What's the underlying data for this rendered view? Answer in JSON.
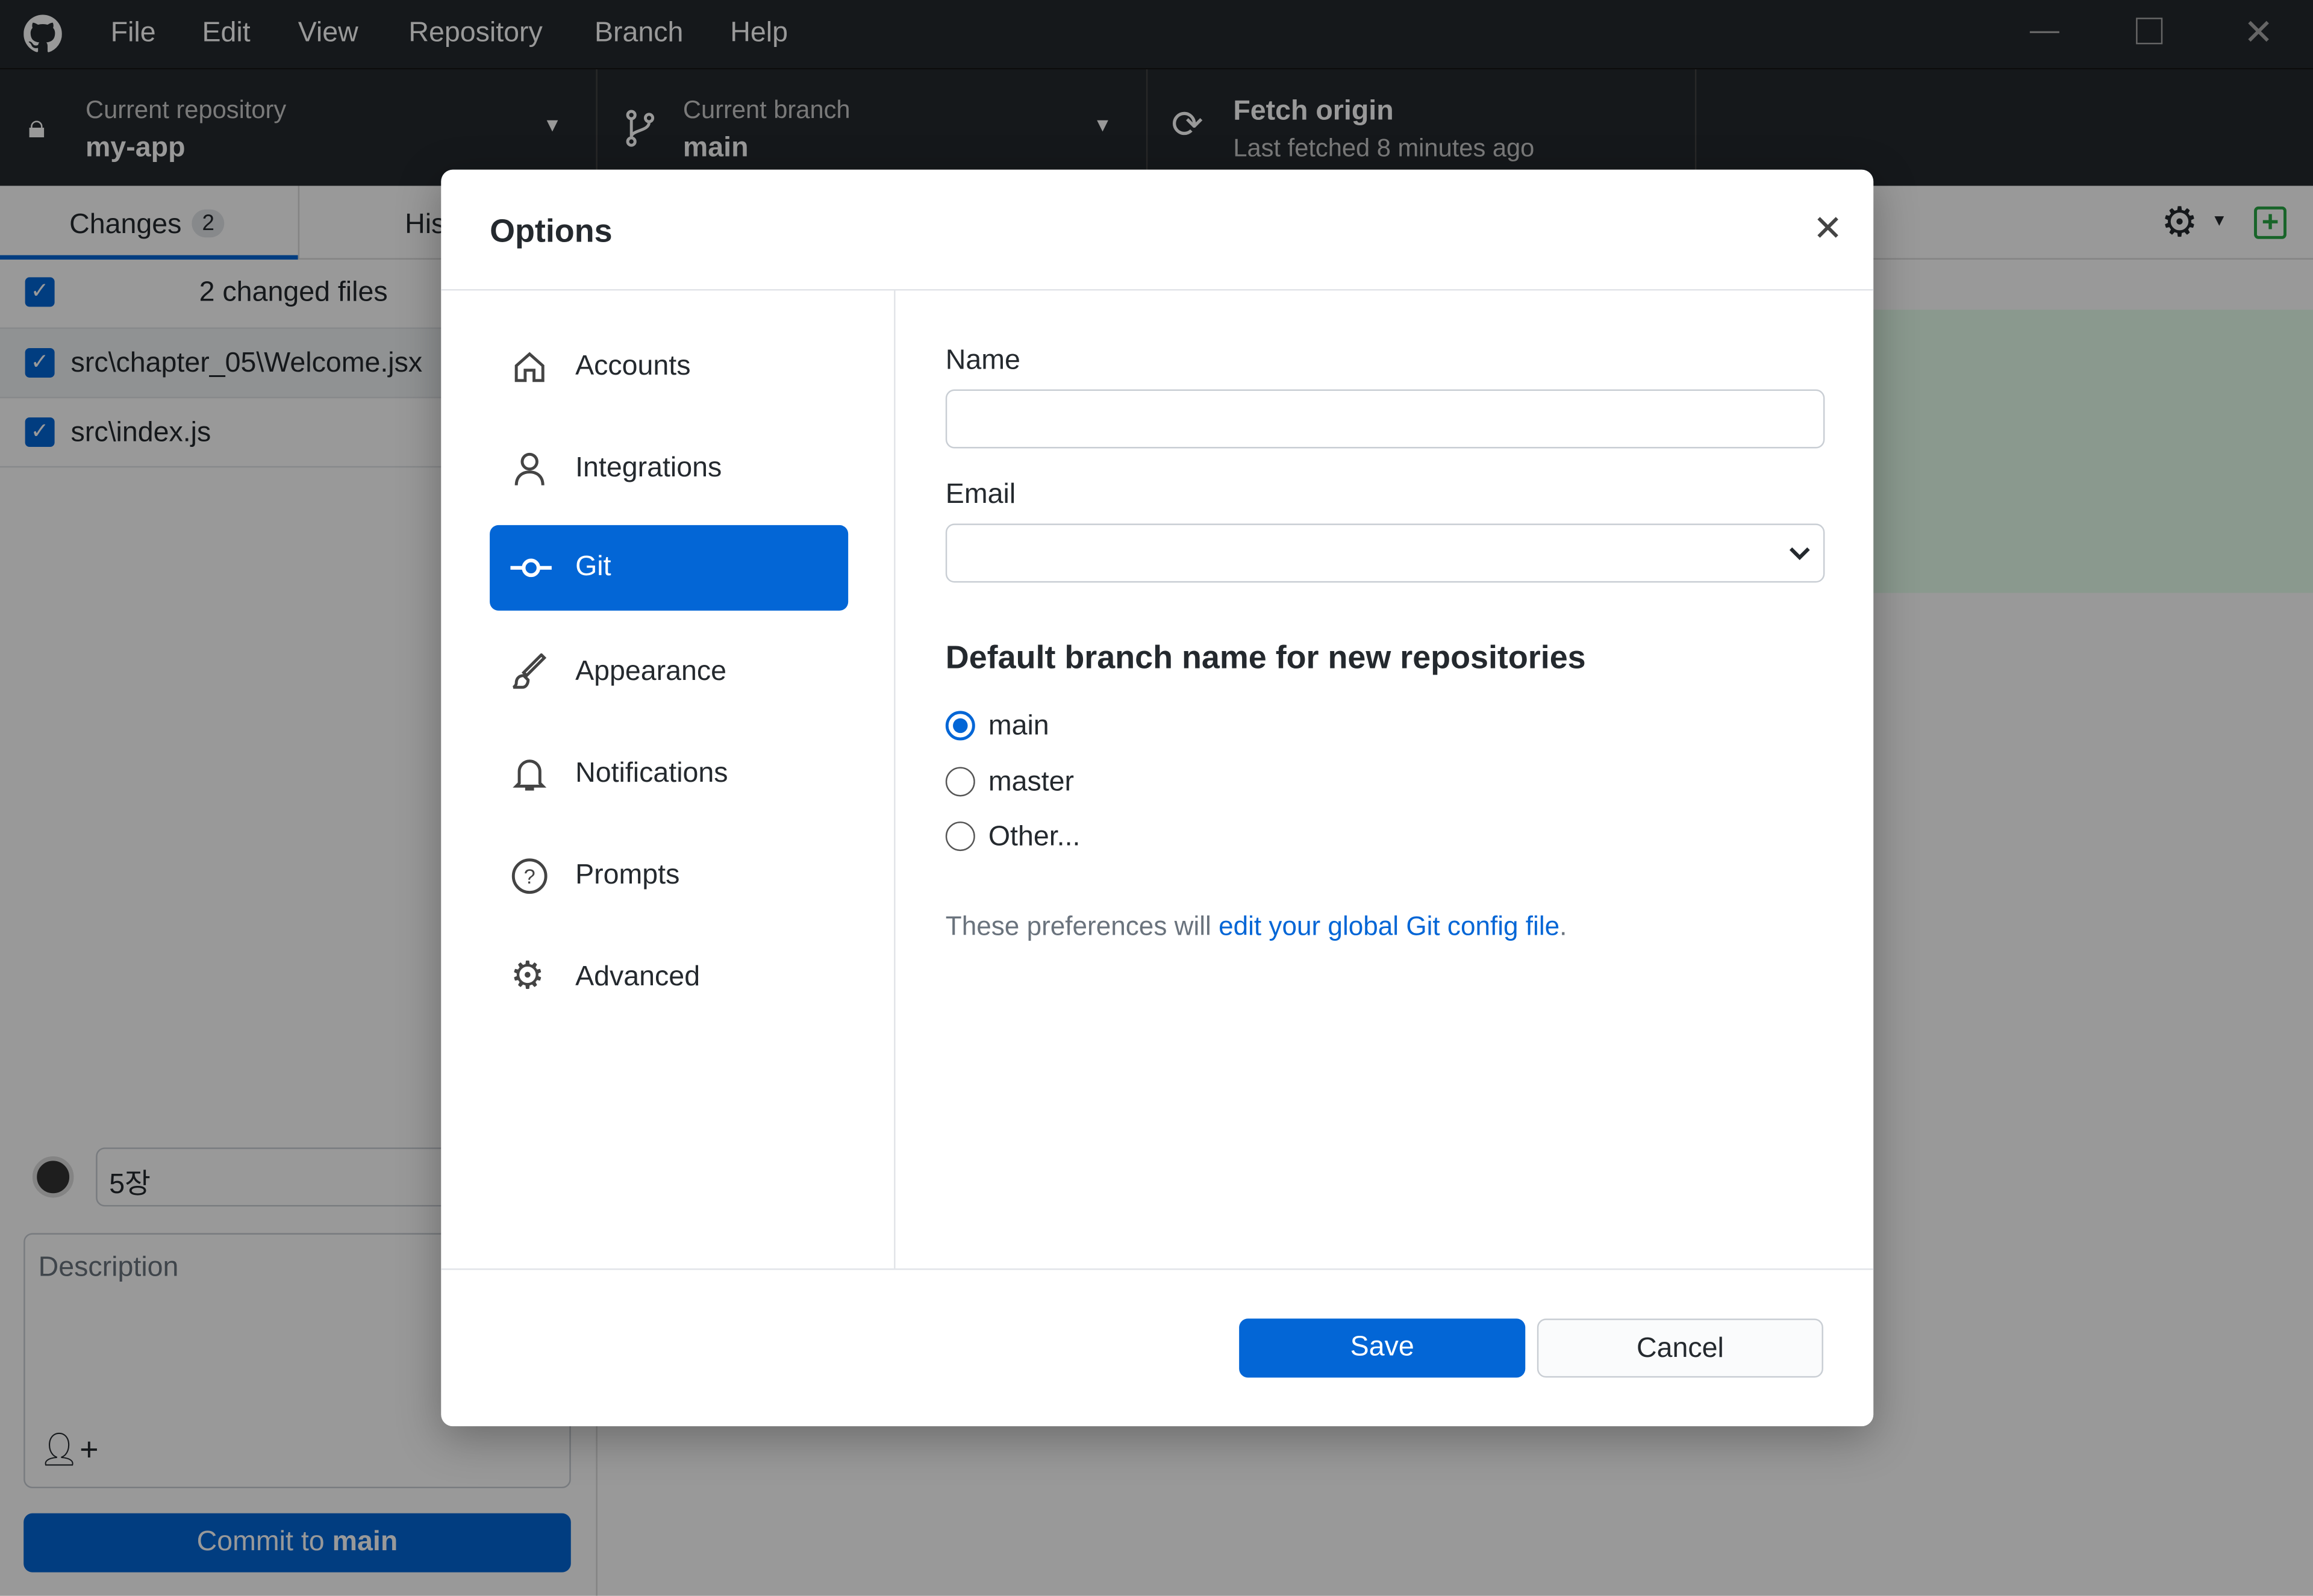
{
  "window": {
    "menu": [
      "File",
      "Edit",
      "View",
      "Repository",
      "Branch",
      "Help"
    ]
  },
  "toolbar": {
    "repo": {
      "label": "Current repository",
      "value": "my-app"
    },
    "branch": {
      "label": "Current branch",
      "value": "main"
    },
    "fetch": {
      "label": "Fetch origin",
      "sub": "Last fetched 8 minutes ago"
    }
  },
  "tabs": {
    "changes": "Changes",
    "changes_count": "2",
    "history": "History"
  },
  "changes": {
    "summary": "2 changed files",
    "files": [
      "src\\chapter_05\\Welcome.jsx",
      "src\\index.js"
    ]
  },
  "commit": {
    "summary": "5장",
    "description_placeholder": "Description",
    "button_prefix": "Commit to ",
    "button_branch": "main"
  },
  "dialog": {
    "title": "Options",
    "nav": [
      "Accounts",
      "Integrations",
      "Git",
      "Appearance",
      "Notifications",
      "Prompts",
      "Advanced"
    ],
    "selected": "Git",
    "name_label": "Name",
    "name_value": "",
    "email_label": "Email",
    "email_value": "",
    "branch_heading": "Default branch name for new repositories",
    "branch_options": [
      "main",
      "master",
      "Other..."
    ],
    "branch_selected": "main",
    "note_prefix": "These preferences will ",
    "note_link": "edit your global Git config file",
    "note_suffix": ".",
    "save": "Save",
    "cancel": "Cancel"
  },
  "colors": {
    "accent": "#0366d6",
    "titlebar": "#24292e"
  }
}
